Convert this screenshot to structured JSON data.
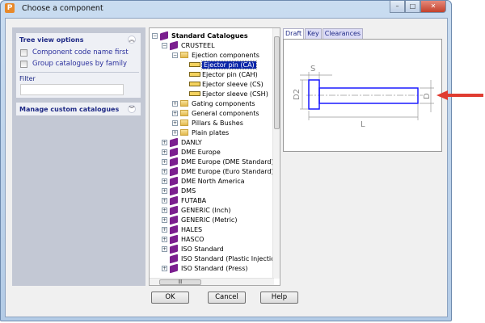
{
  "window": {
    "title": "Choose a component",
    "app_icon": "P"
  },
  "left": {
    "tree_options_title": "Tree view options",
    "opt1": "Component code name first",
    "opt2": "Group catalogues by family",
    "opt1_checked": false,
    "opt2_checked": false,
    "filter_label": "Filter",
    "filter_value": "",
    "manage_title": "Manage custom catalogues"
  },
  "tree": {
    "root": "Standard Catalogues",
    "crusteel": "CRUSTEEL",
    "ejection": "Ejection components",
    "items": [
      "Ejector pin (CA)",
      "Ejector pin (CAH)",
      "Ejector sleeve (CS)",
      "Ejector sleeve (CSH)"
    ],
    "folders": [
      "Gating components",
      "General components",
      "Pillars & Bushes",
      "Plain plates"
    ],
    "catalogues": [
      "DANLY",
      "DME Europe",
      "DME Europe (DME Standard)",
      "DME Europe (Euro Standard)",
      "DME North America",
      "DMS",
      "FUTABA",
      "GENERIC (Inch)",
      "GENERIC (Metric)",
      "HALES",
      "HASCO",
      "ISO Standard",
      "ISO Standard (Plastic Injection)",
      "ISO Standard (Press)"
    ],
    "selected": "Ejector pin (CA)"
  },
  "preview": {
    "tabs": [
      "Draft",
      "Key",
      "Clearances"
    ],
    "active_tab": "Draft",
    "dims": {
      "s": "S",
      "d2": "D2",
      "l": "L",
      "d": "D"
    },
    "outline_color": "#1a1aff",
    "arrow_color": "#e03c31"
  },
  "buttons": {
    "ok": "OK",
    "cancel": "Cancel",
    "help": "Help"
  }
}
